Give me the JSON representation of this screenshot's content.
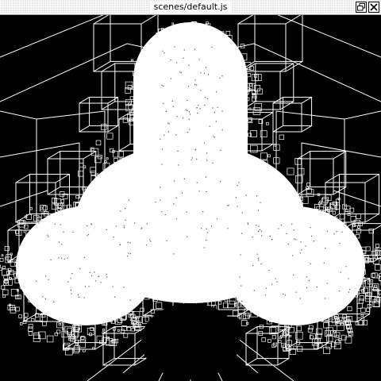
{
  "window": {
    "title": "scenes/default.js",
    "controls": {
      "restore_icon": "restore-icon",
      "close_icon": "close-icon"
    }
  },
  "viewport": {
    "background_color": "#000000",
    "wire_color": "#ffffff",
    "shape_color": "#ffffff",
    "speck_color": "#555555"
  }
}
